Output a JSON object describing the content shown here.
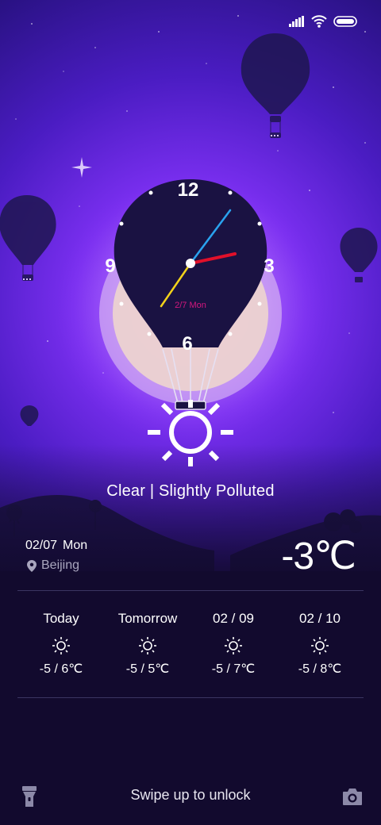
{
  "status_bar": {
    "signal_icon": "signal-bars-icon",
    "wifi_icon": "wifi-icon",
    "battery_icon": "battery-icon"
  },
  "clock": {
    "numerals": {
      "twelve": "12",
      "three": "3",
      "six": "6",
      "nine": "9"
    },
    "date_label": "2/7 Mon",
    "colors": {
      "hour_hand": "#e0102a",
      "minute_hand": "#2aa2ee",
      "second_hand": "#f2d21a",
      "date": "#d4187e"
    }
  },
  "weather": {
    "condition": "Clear | Slightly Polluted",
    "date": "02/07",
    "weekday": "Mon",
    "location": "Beijing",
    "current_temp": "-3℃"
  },
  "forecast": [
    {
      "label": "Today",
      "temp": "-5 / 6℃",
      "icon": "sun-icon"
    },
    {
      "label": "Tomorrow",
      "temp": "-5 / 5℃",
      "icon": "sun-icon"
    },
    {
      "label": "02 / 09",
      "temp": "-5 / 7℃",
      "icon": "sun-icon"
    },
    {
      "label": "02 / 10",
      "temp": "-5 / 8℃",
      "icon": "sun-icon"
    }
  ],
  "bottom": {
    "unlock_text": "Swipe up to unlock",
    "flashlight_icon": "flashlight-icon",
    "camera_icon": "camera-icon"
  },
  "colors": {
    "sky_center": "#8a3cf0",
    "sky_mid": "#5a1fd0",
    "sky_dark": "#170e3e",
    "ground": "#120a2e",
    "balloon": "#1a1242"
  }
}
